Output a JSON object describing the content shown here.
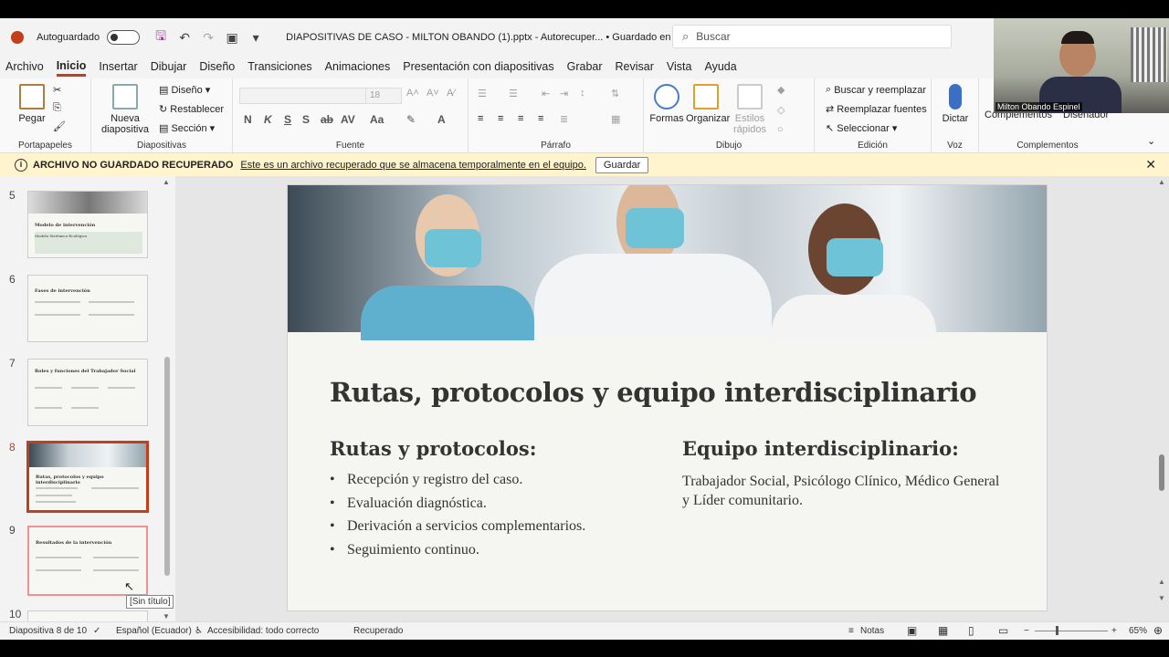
{
  "titlebar": {
    "autosave_label": "Autoguardado",
    "document_title": "DIAPOSITIVAS DE CASO - MILTON OBANDO (1).pptx  -  Autorecuper...  •  Guardado en Este PC",
    "search_placeholder": "Buscar"
  },
  "menu": {
    "tabs": [
      "Archivo",
      "Inicio",
      "Insertar",
      "Dibujar",
      "Diseño",
      "Transiciones",
      "Animaciones",
      "Presentación con diapositivas",
      "Grabar",
      "Revisar",
      "Vista",
      "Ayuda"
    ],
    "active": "Inicio"
  },
  "ribbon": {
    "portapapeles": {
      "label": "Portapapeles",
      "pegar": "Pegar"
    },
    "diapositivas": {
      "label": "Diapositivas",
      "nueva": "Nueva diapositiva",
      "diseno": "Diseño",
      "restablecer": "Restablecer",
      "seccion": "Sección"
    },
    "fuente": {
      "label": "Fuente",
      "size": "18"
    },
    "parrafo": {
      "label": "Párrafo"
    },
    "dibujo": {
      "label": "Dibujo",
      "formas": "Formas",
      "organizar": "Organizar",
      "estilos": "Estilos rápidos"
    },
    "edicion": {
      "label": "Edición",
      "buscar": "Buscar y reemplazar",
      "reemplazar": "Reemplazar fuentes",
      "seleccionar": "Seleccionar"
    },
    "voz": {
      "label": "Voz",
      "dictar": "Dictar"
    },
    "complementos": {
      "label": "Complementos",
      "complementos_btn": "Complementos",
      "disenador": "Diseñador"
    }
  },
  "infobar": {
    "title": "ARCHIVO NO GUARDADO RECUPERADO",
    "message": "Este es un archivo recuperado que se almacena temporalmente en el equipo.",
    "save_label": "Guardar"
  },
  "thumbnails": [
    {
      "num": "5",
      "title": "Modelo de intervención",
      "sub": "Modelo Sistémico-Ecológico"
    },
    {
      "num": "6",
      "title": "Fases de intervención",
      "sub": ""
    },
    {
      "num": "7",
      "title": "Roles y funciones del Trabajador Social",
      "sub": ""
    },
    {
      "num": "8",
      "title": "Rutas, protocolos y equipo interdisciplinario",
      "sub": ""
    },
    {
      "num": "9",
      "title": "Resultados de la intervención",
      "sub": ""
    },
    {
      "num": "10",
      "title": "",
      "sub": ""
    }
  ],
  "tooltip": "[Sin título]",
  "slide": {
    "title": "Rutas, protocolos y equipo interdisciplinario",
    "left_heading": "Rutas y protocolos:",
    "bullets": [
      "Recepción y registro del caso.",
      "Evaluación diagnóstica.",
      "Derivación a servicios complementarios.",
      "Seguimiento continuo."
    ],
    "right_heading": "Equipo interdisciplinario:",
    "right_text": "Trabajador Social, Psicólogo Clínico, Médico General y Líder comunitario."
  },
  "statusbar": {
    "slide_info": "Diapositiva 8 de 10",
    "language": "Español (Ecuador)",
    "accessibility": "Accesibilidad: todo correcto",
    "recovered": "Recuperado",
    "notes": "Notas",
    "zoom": "65%"
  },
  "webcam": {
    "name": "Milton Obando Espinel"
  },
  "colors": {
    "accent": "#c43e1c",
    "infobar_bg": "#fff4ce",
    "slide_bg": "#f5f6f2"
  }
}
